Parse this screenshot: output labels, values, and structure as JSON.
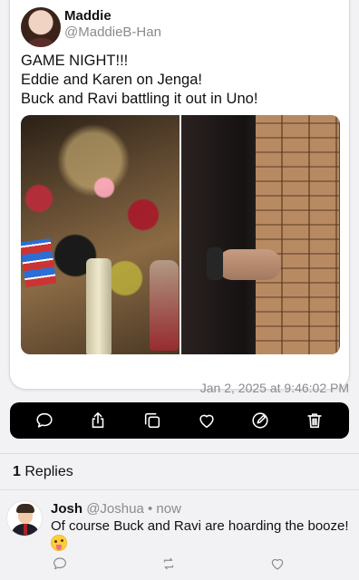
{
  "post": {
    "author_name": "Maddie",
    "author_handle": "@MaddieB-Han",
    "text_lines": [
      "GAME NIGHT!!!",
      "Eddie and Karen on Jenga!",
      "Buck and Ravi battling it out in Uno!"
    ],
    "timestamp": "Jan 2, 2025 at 9:46:02 PM"
  },
  "toolbar": {
    "icons": [
      "reply-icon",
      "share-icon",
      "copy-icon",
      "like-icon",
      "edit-icon",
      "delete-icon"
    ]
  },
  "replies": {
    "count": "1",
    "label": "Replies"
  },
  "reply": {
    "name": "Josh",
    "handle": "@Joshua",
    "dot": "•",
    "time": "now",
    "text": "Of course Buck and Ravi are hoarding the booze!",
    "emoji": "🤪"
  },
  "colors": {
    "toolbar_bg": "#000000",
    "muted_text": "#8a8a90"
  }
}
